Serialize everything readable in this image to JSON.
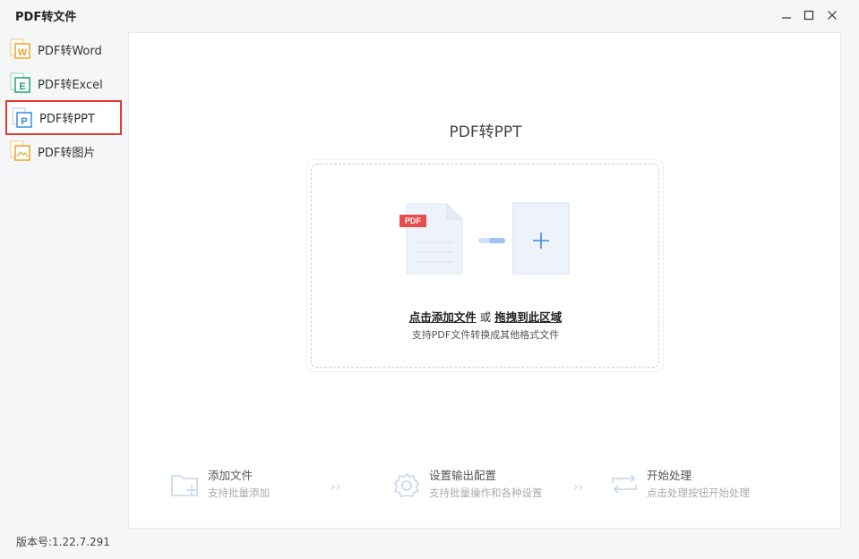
{
  "window": {
    "title": "PDF转文件",
    "controls": [
      "minimize-icon",
      "maximize-icon",
      "close-icon"
    ]
  },
  "sidebar": {
    "items": [
      {
        "label": "PDF转Word",
        "icon": "word-file-icon",
        "letter": "W",
        "color": "#f4a024"
      },
      {
        "label": "PDF转Excel",
        "icon": "excel-file-icon",
        "letter": "E",
        "color": "#20a36a"
      },
      {
        "label": "PDF转PPT",
        "icon": "ppt-file-icon",
        "letter": "P",
        "color": "#3d8ae6",
        "active": true
      },
      {
        "label": "PDF转图片",
        "icon": "image-file-icon",
        "letter": "",
        "color": "#f4a024"
      }
    ]
  },
  "main": {
    "title": "PDF转PPT",
    "drop": {
      "pdf_badge": "PDF",
      "add_link": "点击添加文件",
      "or_text": "或",
      "drag_link": "拖拽到此区域",
      "hint": "支持PDF文件转换成其他格式文件"
    },
    "steps": [
      {
        "title": "添加文件",
        "desc": "支持批量添加",
        "icon": "add-folder-icon"
      },
      {
        "title": "设置输出配置",
        "desc": "支持批量操作和各种设置",
        "icon": "gear-icon"
      },
      {
        "title": "开始处理",
        "desc": "点击处理按钮开始处理",
        "icon": "loop-arrows-icon"
      }
    ]
  },
  "footer": {
    "version": "版本号:1.22.7.291"
  },
  "colors": {
    "accent": "#3d8ae6",
    "active_border": "#e53935",
    "pdf_red": "#e84b4b"
  }
}
